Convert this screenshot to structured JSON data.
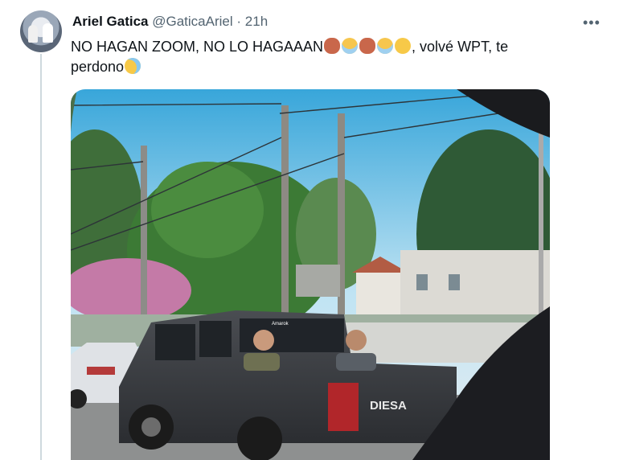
{
  "tweet": {
    "author_name": "Ariel Gatica",
    "handle": "@GaticaAriel",
    "separator": "·",
    "time": "21h",
    "more_label": "•••",
    "text_main": "NO HAGAN ZOOM, NO LO HAGAAAN",
    "text_tail": ", volvé WPT, te",
    "text_line2": "perdono",
    "emojis": [
      "see-no-evil-monkey",
      "screaming-face",
      "see-no-evil-monkey",
      "screaming-face",
      "grinning-sweat-face",
      "crying-face"
    ]
  },
  "photo": {
    "truck_brand": "DIESA",
    "window_sticker": "Amarok"
  }
}
